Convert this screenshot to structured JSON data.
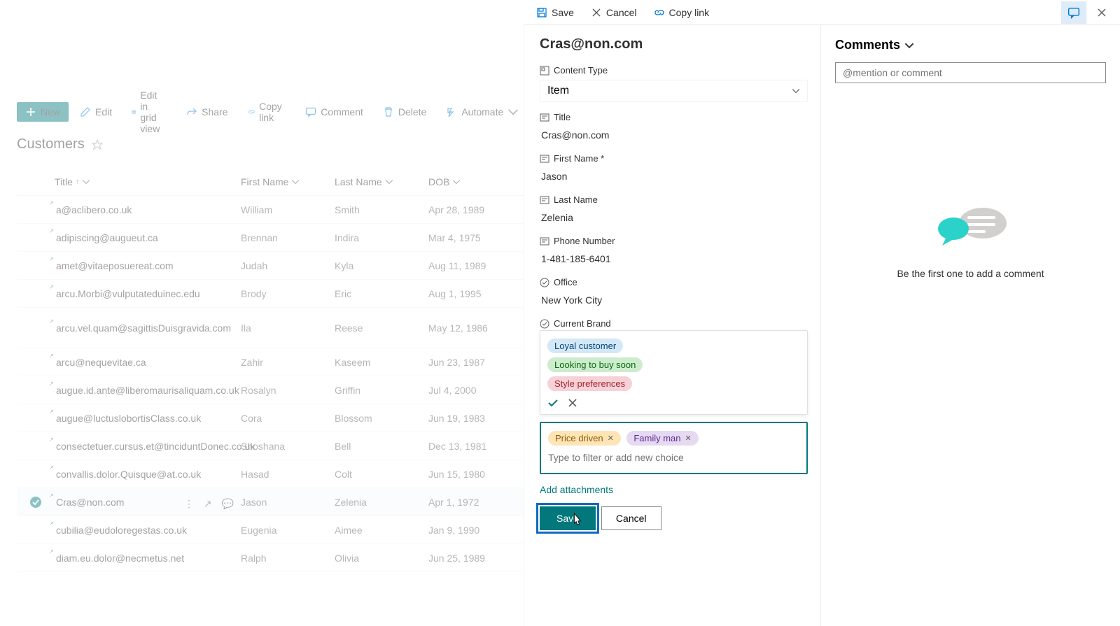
{
  "toolbar": {
    "save": "Save",
    "cancel": "Cancel",
    "copylink": "Copy link"
  },
  "cmdbar": {
    "new": "New",
    "edit": "Edit",
    "grid": "Edit in grid view",
    "share": "Share",
    "copylink": "Copy link",
    "comment": "Comment",
    "delete": "Delete",
    "automate": "Automate"
  },
  "list": {
    "title": "Customers",
    "columns": {
      "title": "Title",
      "first": "First Name",
      "last": "Last Name",
      "dob": "DOB"
    },
    "rows": [
      {
        "title": "a@aclibero.co.uk",
        "first": "William",
        "last": "Smith",
        "dob": "Apr 28, 1989"
      },
      {
        "title": "adipiscing@augueut.ca",
        "first": "Brennan",
        "last": "Indira",
        "dob": "Mar 4, 1975"
      },
      {
        "title": "amet@vitaeposuereat.com",
        "first": "Judah",
        "last": "Kyla",
        "dob": "Aug 11, 1989"
      },
      {
        "title": "arcu.Morbi@vulputateduinec.edu",
        "first": "Brody",
        "last": "Eric",
        "dob": "Aug 1, 1995"
      },
      {
        "title": "arcu.vel.quam@sagittisDuisgravida.com",
        "first": "Ila",
        "last": "Reese",
        "dob": "May 12, 1986"
      },
      {
        "title": "arcu@nequevitae.ca",
        "first": "Zahir",
        "last": "Kaseem",
        "dob": "Jun 23, 1987"
      },
      {
        "title": "augue.id.ante@liberomaurisaliquam.co.uk",
        "first": "Rosalyn",
        "last": "Griffin",
        "dob": "Jul 4, 2000"
      },
      {
        "title": "augue@luctuslobortisClass.co.uk",
        "first": "Cora",
        "last": "Blossom",
        "dob": "Jun 19, 1983"
      },
      {
        "title": "consectetuer.cursus.et@tinciduntDonec.co.uk",
        "first": "Shoshana",
        "last": "Bell",
        "dob": "Dec 13, 1981"
      },
      {
        "title": "convallis.dolor.Quisque@at.co.uk",
        "first": "Hasad",
        "last": "Colt",
        "dob": "Jun 15, 1980"
      },
      {
        "title": "Cras@non.com",
        "first": "Jason",
        "last": "Zelenia",
        "dob": "Apr 1, 1972",
        "selected": true
      },
      {
        "title": "cubilia@eudoloregestas.co.uk",
        "first": "Eugenia",
        "last": "Aimee",
        "dob": "Jan 9, 1990"
      },
      {
        "title": "diam.eu.dolor@necmetus.net",
        "first": "Ralph",
        "last": "Olivia",
        "dob": "Jun 25, 1989"
      }
    ]
  },
  "form": {
    "heading": "Cras@non.com",
    "contentTypeLabel": "Content Type",
    "contentTypeValue": "Item",
    "titleLabel": "Title",
    "titleValue": "Cras@non.com",
    "firstLabel": "First Name *",
    "firstValue": "Jason",
    "lastLabel": "Last Name",
    "lastValue": "Zelenia",
    "phoneLabel": "Phone Number",
    "phoneValue": "1-481-185-6401",
    "officeLabel": "Office",
    "officeValue": "New York City",
    "brandLabel": "Current Brand",
    "choices": {
      "loyal": "Loyal customer",
      "looking": "Looking to buy soon",
      "style": "Style preferences"
    },
    "tags": {
      "price": "Price driven",
      "family": "Family man",
      "placeholder": "Type to filter or add new choice"
    },
    "attach": "Add attachments",
    "save": "Save",
    "cancel": "Cancel"
  },
  "comments": {
    "heading": "Comments",
    "placeholder": "@mention or comment",
    "empty": "Be the first one to add a comment"
  }
}
